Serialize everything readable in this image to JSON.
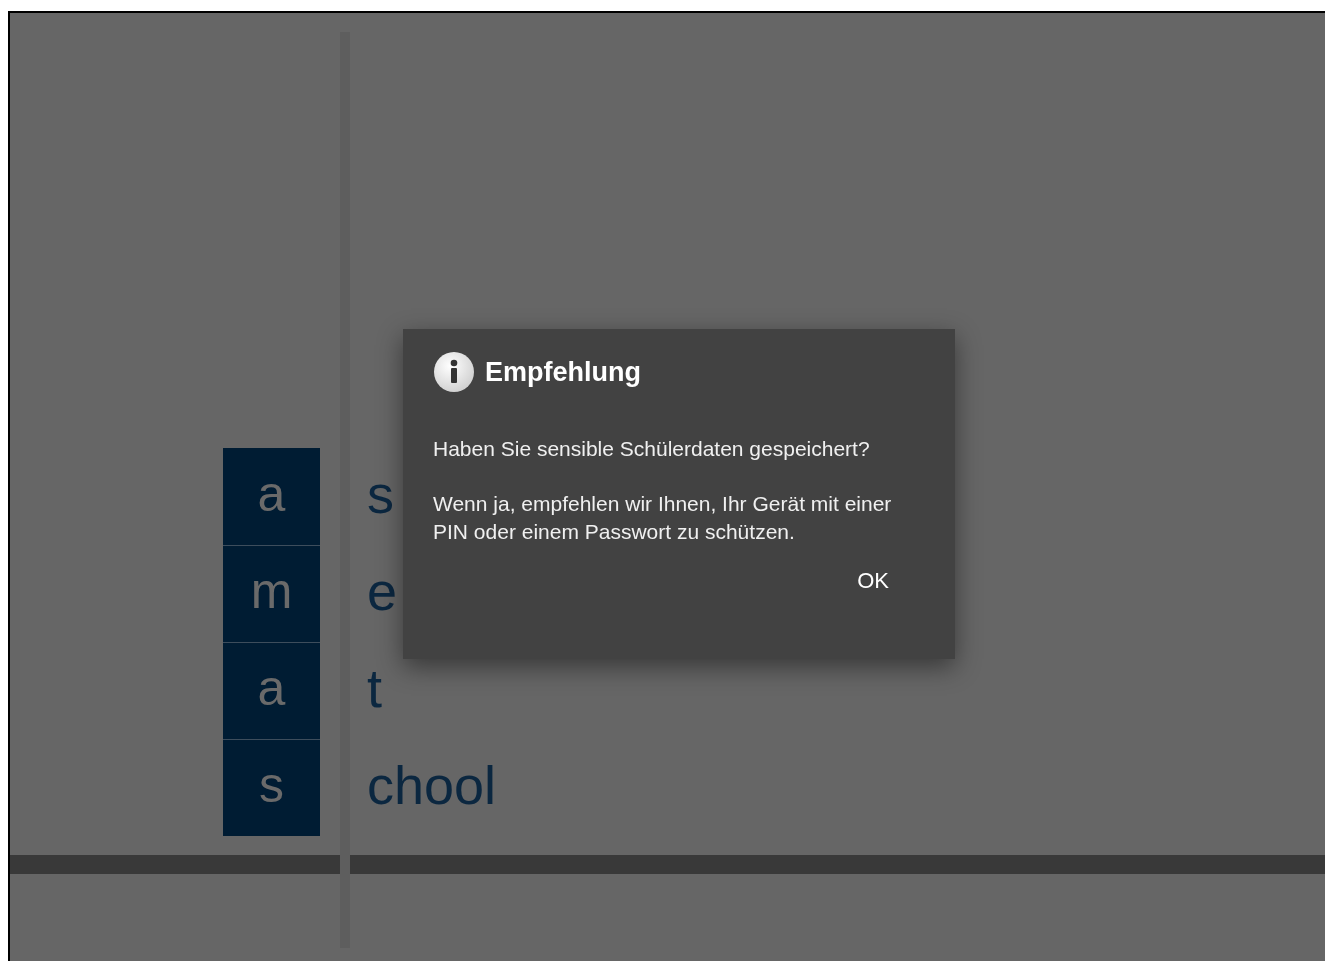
{
  "word_rows": [
    {
      "letter": "a",
      "word": "s"
    },
    {
      "letter": "m",
      "word": "e"
    },
    {
      "letter": "a",
      "word": "t"
    },
    {
      "letter": "s",
      "word": "chool"
    }
  ],
  "dialog": {
    "title": "Empfehlung",
    "message": "Haben Sie sensible Schülerdaten gespeichert?",
    "detail": "Wenn ja, empfehlen wir Ihnen, Ihr Gerät mit einer PIN oder einem Passwort zu schützen.",
    "buttons": [
      "OK"
    ]
  }
}
